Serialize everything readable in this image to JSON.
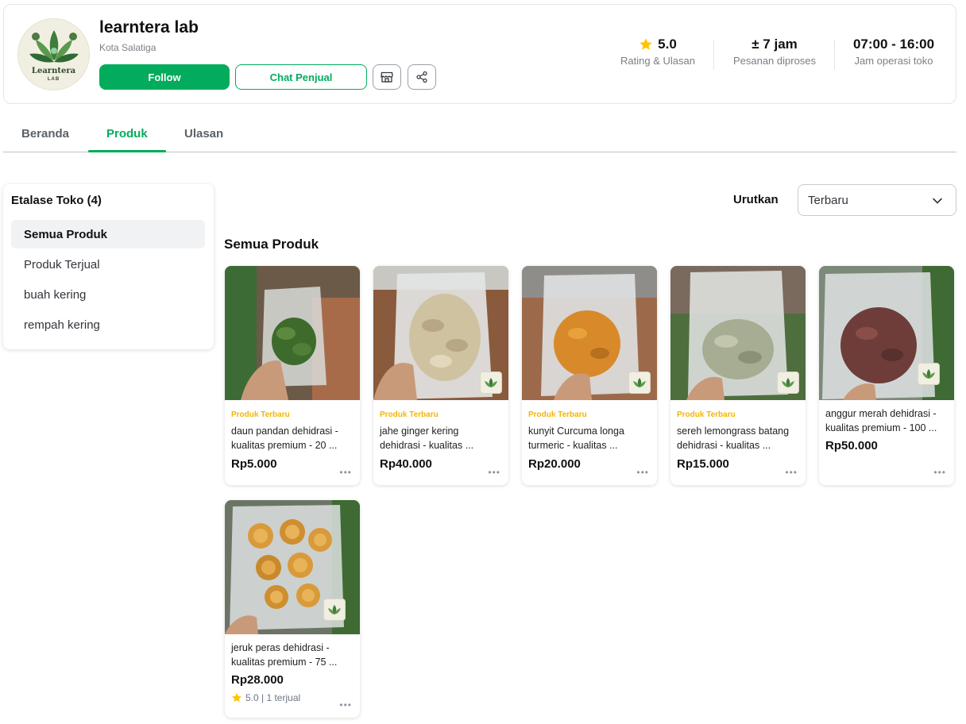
{
  "shop": {
    "name": "learntera lab",
    "city": "Kota Salatiga",
    "logo_text": "Learntera",
    "logo_sub": "LAB",
    "follow_label": "Follow",
    "chat_label": "Chat Penjual",
    "stats": {
      "rating_value": "5.0",
      "rating_label": "Rating & Ulasan",
      "process_value": "± 7 jam",
      "process_label": "Pesanan diproses",
      "hours_value": "07:00 - 16:00",
      "hours_label": "Jam operasi toko"
    }
  },
  "tabs": [
    {
      "label": "Beranda"
    },
    {
      "label": "Produk"
    },
    {
      "label": "Ulasan"
    }
  ],
  "sidebar": {
    "title": "Etalase Toko (4)",
    "items": [
      {
        "label": "Semua Produk"
      },
      {
        "label": "Produk Terjual"
      },
      {
        "label": "buah kering"
      },
      {
        "label": "rempah kering"
      }
    ]
  },
  "sort": {
    "label": "Urutkan",
    "selected": "Terbaru"
  },
  "section_title": "Semua Produk",
  "products": [
    {
      "badge": "Produk Terbaru",
      "name_line1": "daun pandan dehidrasi -",
      "name_line2": "kualitas premium - 20 ...",
      "price": "Rp5.000"
    },
    {
      "badge": "Produk Terbaru",
      "name_line1": "jahe ginger kering",
      "name_line2": "dehidrasi - kualitas ...",
      "price": "Rp40.000"
    },
    {
      "badge": "Produk Terbaru",
      "name_line1": "kunyit Curcuma longa",
      "name_line2": "turmeric - kualitas ...",
      "price": "Rp20.000"
    },
    {
      "badge": "Produk Terbaru",
      "name_line1": "sereh lemongrass batang",
      "name_line2": "dehidrasi - kualitas ...",
      "price": "Rp15.000"
    },
    {
      "badge": "",
      "name_line1": "anggur merah dehidrasi -",
      "name_line2": "kualitas premium - 100 ...",
      "price": "Rp50.000"
    },
    {
      "badge": "",
      "name_line1": "jeruk peras dehidrasi -",
      "name_line2": "kualitas premium - 75 ...",
      "price": "Rp28.000",
      "rating": "5.0 | 1 terjual"
    }
  ],
  "colors": {
    "brand_green": "#03ac5c",
    "badge_yellow": "#f3b600",
    "star": "#ffc400"
  },
  "icons": [
    "star-icon",
    "store-icon",
    "share-icon",
    "chevron-down-icon",
    "more-icon"
  ]
}
